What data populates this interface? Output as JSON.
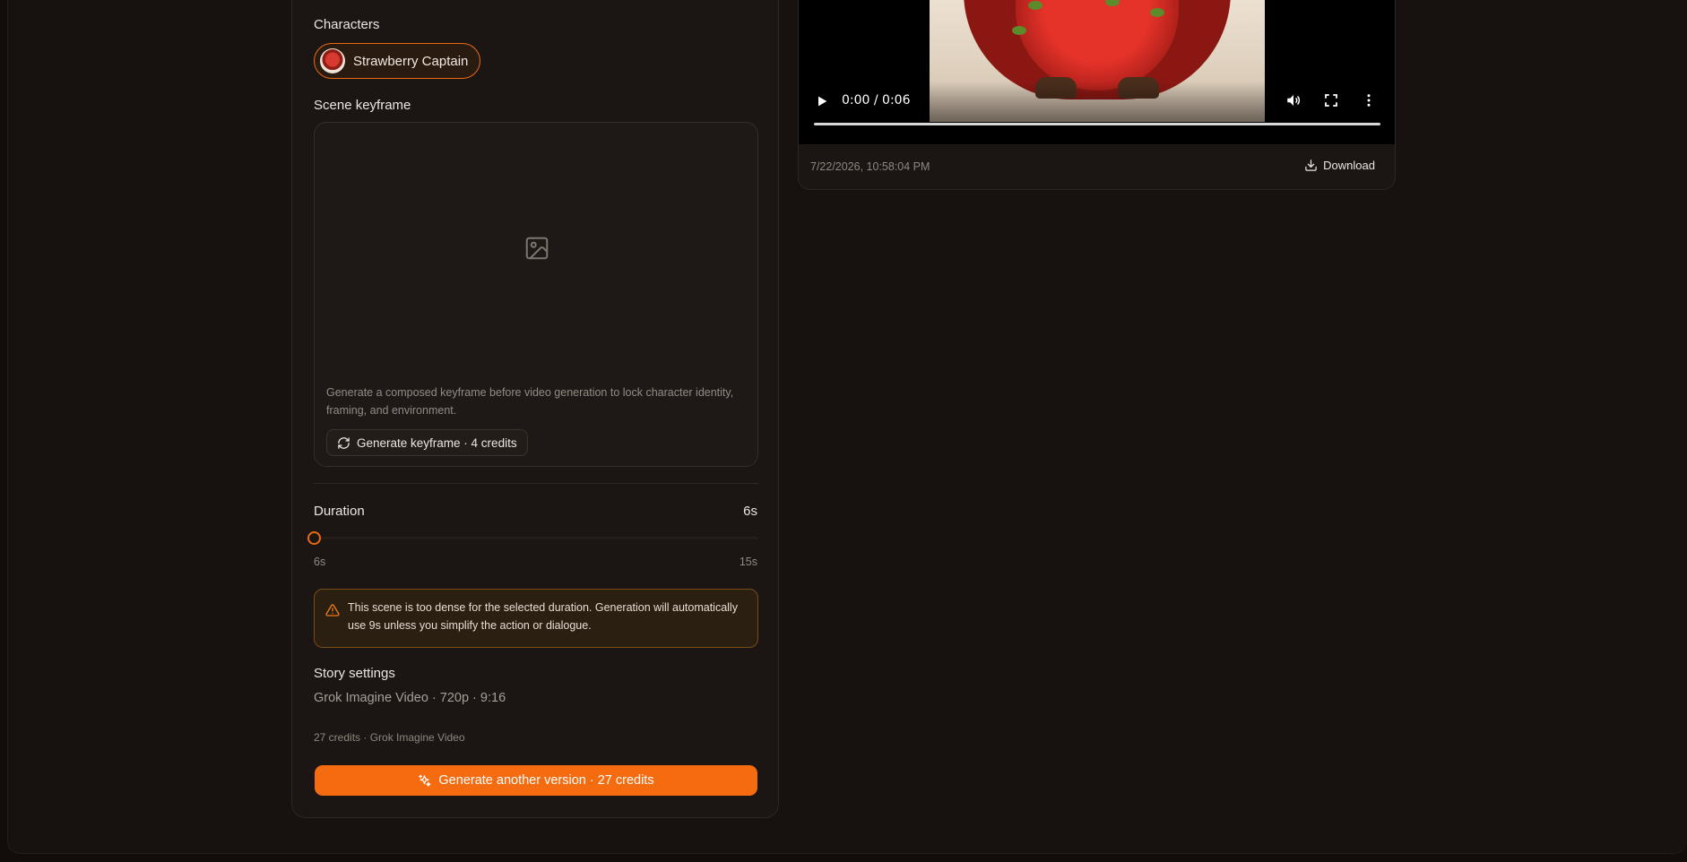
{
  "form": {
    "characters_label": "Characters",
    "character_chip": "Strawberry Captain",
    "keyframe_label": "Scene keyframe",
    "keyframe_help": "Generate a composed keyframe before video generation to lock character identity, framing, and environment.",
    "keyframe_button": "Generate keyframe · 4 credits",
    "duration_label": "Duration",
    "duration_value": "6s",
    "duration_min": "6s",
    "duration_max": "15s",
    "duration_fraction": 0,
    "warning": "This scene is too dense for the selected duration. Generation will automatically use 9s unless you simplify the action or dialogue.",
    "story_settings_label": "Story settings",
    "story_settings_summary": "Grok Imagine Video · 720p · 9:16",
    "cost_line": "27 credits · Grok Imagine Video",
    "generate_button": "Generate another version · 27 credits"
  },
  "video": {
    "time": "0:00 / 0:06",
    "progress_fraction": 0,
    "timestamp": "7/22/2026, 10:58:04 PM",
    "download_label": "Download"
  },
  "colors": {
    "accent": "#f56b10",
    "background": "#120d0a",
    "panel": "#1b1613",
    "warning_bg": "#2b1f12"
  },
  "icons": [
    "image-icon",
    "refresh-icon",
    "warning-icon",
    "sparkles-icon",
    "play-icon",
    "volume-icon",
    "fullscreen-icon",
    "more-vertical-icon",
    "download-icon"
  ]
}
